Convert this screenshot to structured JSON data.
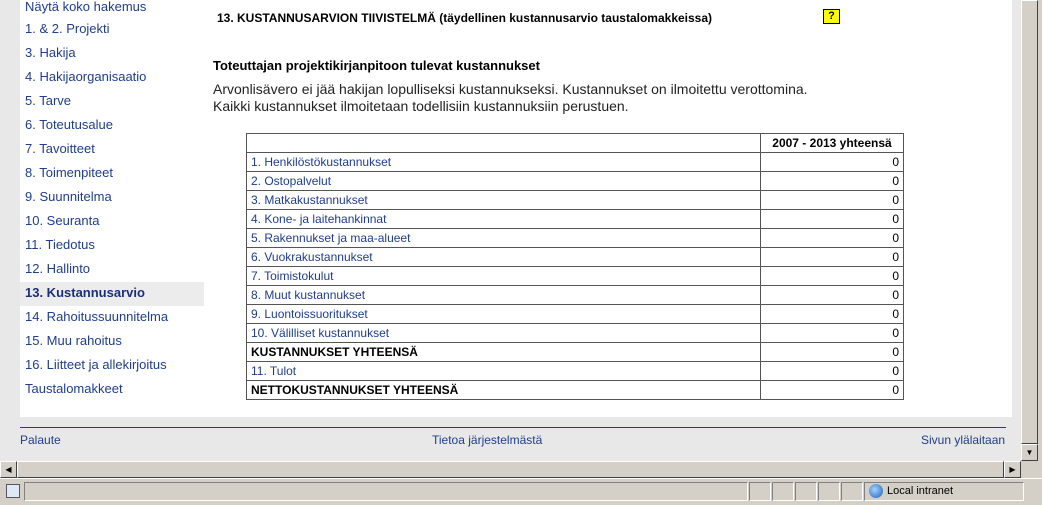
{
  "sidebar": {
    "items": [
      {
        "label": "Näytä koko hakemus"
      },
      {
        "label": "1. & 2. Projekti"
      },
      {
        "label": "3. Hakija"
      },
      {
        "label": "4. Hakijaorganisaatio"
      },
      {
        "label": "5. Tarve"
      },
      {
        "label": "6. Toteutusalue"
      },
      {
        "label": "7. Tavoitteet"
      },
      {
        "label": "8. Toimenpiteet"
      },
      {
        "label": "9. Suunnitelma"
      },
      {
        "label": "10. Seuranta"
      },
      {
        "label": "11. Tiedotus"
      },
      {
        "label": "12. Hallinto"
      },
      {
        "label": "13. Kustannusarvio"
      },
      {
        "label": "14. Rahoitussuunnitelma"
      },
      {
        "label": "15. Muu rahoitus"
      },
      {
        "label": "16. Liitteet ja allekirjoitus"
      },
      {
        "label": "Taustalomakkeet"
      }
    ]
  },
  "main": {
    "title": "13.  KUSTANNUSARVION TIIVISTELMÄ (täydellinen kustannusarvio taustalomakkeissa)",
    "help_label": "?",
    "section_heading": "Toteuttajan projektikirjanpitoon tulevat kustannukset",
    "intro_line1": "Arvonlisävero ei jää hakijan lopulliseksi kustannukseksi. Kustannukset on ilmoitettu verottomina.",
    "intro_line2": "Kaikki kustannukset ilmoitetaan todellisiin kustannuksiin perustuen.",
    "table": {
      "header_empty": "",
      "header_total": "2007 - 2013 yhteensä",
      "rows": [
        {
          "label": "1. Henkilöstökustannukset",
          "value": "0"
        },
        {
          "label": "2. Ostopalvelut",
          "value": "0"
        },
        {
          "label": "3. Matkakustannukset",
          "value": "0"
        },
        {
          "label": "4. Kone- ja laitehankinnat",
          "value": "0"
        },
        {
          "label": "5. Rakennukset ja maa-alueet",
          "value": "0"
        },
        {
          "label": "6. Vuokrakustannukset",
          "value": "0"
        },
        {
          "label": "7. Toimistokulut",
          "value": "0"
        },
        {
          "label": "8. Muut kustannukset",
          "value": "0"
        },
        {
          "label": "9. Luontoissuoritukset",
          "value": "0"
        },
        {
          "label": "10. Välilliset kustannukset",
          "value": "0"
        },
        {
          "label": "KUSTANNUKSET YHTEENSÄ",
          "value": "0"
        },
        {
          "label": "11. Tulot",
          "value": "0"
        },
        {
          "label": "NETTOKUSTANNUKSET YHTEENSÄ",
          "value": "0"
        }
      ]
    }
  },
  "footer": {
    "feedback": "Palaute",
    "about": "Tietoa järjestelmästä",
    "top": "Sivun ylälaitaan"
  },
  "statusbar": {
    "zone": "Local intranet"
  },
  "colors": {
    "link": "#1f3d8c",
    "help_bg": "#ffff00",
    "chrome": "#d4d0c8"
  },
  "icons": {
    "help": "help-icon",
    "zone": "globe-icon",
    "page": "page-icon"
  }
}
